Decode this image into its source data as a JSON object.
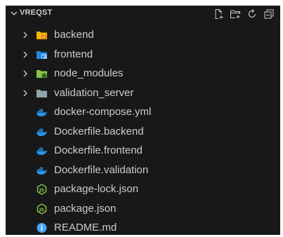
{
  "explorer": {
    "title": "VREQST",
    "actions": [
      {
        "icon": "new-file-icon"
      },
      {
        "icon": "new-folder-icon"
      },
      {
        "icon": "refresh-icon"
      },
      {
        "icon": "collapse-all-icon"
      }
    ]
  },
  "tree": {
    "items": [
      {
        "label": "backend",
        "kind": "folder",
        "icon": "folder-backend-icon"
      },
      {
        "label": "frontend",
        "kind": "folder",
        "icon": "folder-frontend-icon"
      },
      {
        "label": "node_modules",
        "kind": "folder",
        "icon": "folder-node-icon"
      },
      {
        "label": "validation_server",
        "kind": "folder",
        "icon": "folder-icon"
      },
      {
        "label": "docker-compose.yml",
        "kind": "file",
        "icon": "docker-icon"
      },
      {
        "label": "Dockerfile.backend",
        "kind": "file",
        "icon": "docker-icon"
      },
      {
        "label": "Dockerfile.frontend",
        "kind": "file",
        "icon": "docker-icon"
      },
      {
        "label": "Dockerfile.validation",
        "kind": "file",
        "icon": "docker-icon"
      },
      {
        "label": "package-lock.json",
        "kind": "file",
        "icon": "nodejs-icon"
      },
      {
        "label": "package.json",
        "kind": "file",
        "icon": "nodejs-icon"
      },
      {
        "label": "README.md",
        "kind": "file",
        "icon": "info-icon"
      }
    ]
  },
  "colors": {
    "background": "#181818",
    "text": "#cccccc",
    "docker": "#2496ed",
    "node": "#8cc84b",
    "backend_folder": "#f4b400",
    "frontend_folder": "#1e88e5",
    "node_folder": "#8bc34a",
    "plain_folder": "#90a4ae",
    "info": "#42a5f5"
  }
}
